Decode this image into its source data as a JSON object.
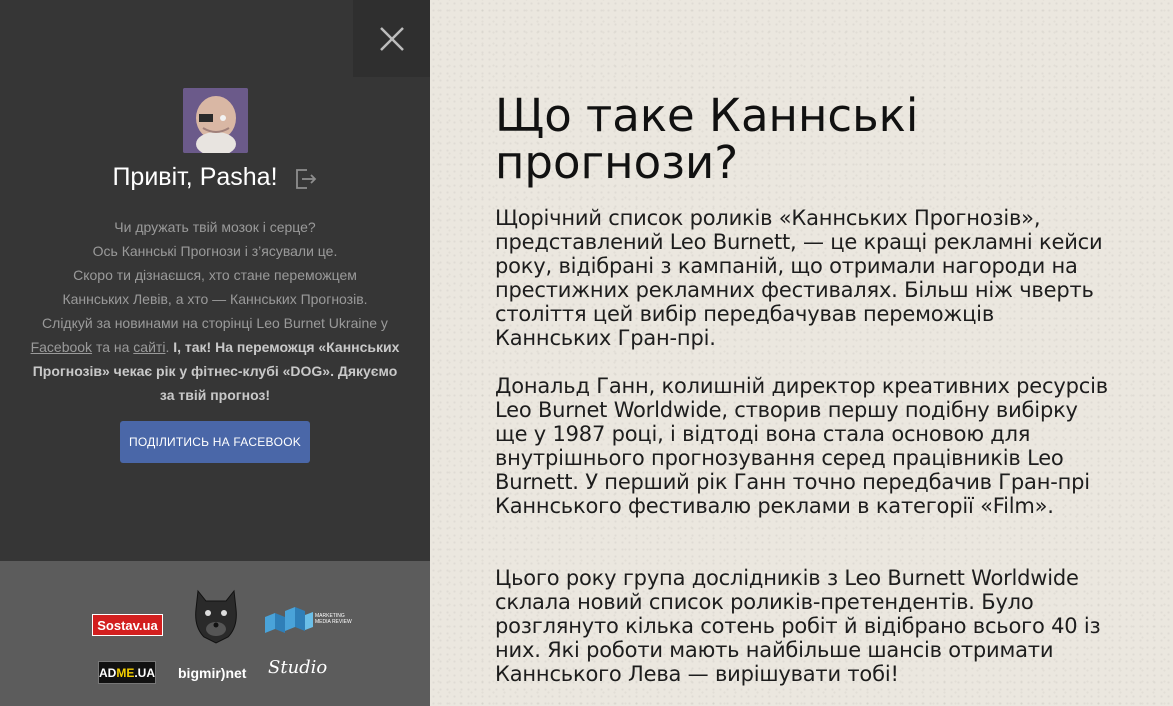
{
  "sidebar": {
    "close_icon": "close-icon",
    "avatar_icon": "avatar",
    "greeting": "Привіт, Pasha!",
    "logout_icon": "logout-icon",
    "intro": {
      "line1": "Чи дружать твій мозок і серце?",
      "line2": "Ось Каннські Прогнози і з’ясували це.",
      "line3": "Скоро ти дізнаєшся, хто стане переможцем",
      "line4": "Каннських Левів, а хто — Каннських Прогнозів.",
      "line5": "Слідкуй за новинами на сторінці Leo Burnet Ukraine у",
      "facebook_link": "Facebook",
      "and_on": " та на ",
      "site_link": "сайті",
      "dot": ". ",
      "bold_text": "І, так! На переможця «Каннських Прогнозів» чекає рік у фітнес-клубі «DOG». Дякуємо за твій прогноз!"
    },
    "share_button": "ПОДІЛИТИСЬ НА FACEBOOK",
    "partners": {
      "sostav": "Sostav.ua",
      "mmr_label": "MARKETING MEDIA REVIEW",
      "adme_ad": "AD",
      "adme_me": "ME",
      "adme_ua": ".UA",
      "bigmir": "bigmir)net",
      "studio": "Studio"
    }
  },
  "content": {
    "title": "Що таке Каннські прогнози?",
    "paragraph1": "Щорічний список роликів «Каннських Прогнозів», представлений Leo Burnett, — це кращі рекламні кейси року, відібрані з кампаній, що отримали нагороди на престижних рекламних фестивалях. Більш ніж чверть століття цей вибір передбачував переможців Каннських Гран-прі.",
    "paragraph2": "Дональд Ганн, колишній директор креативних ресурсів Leo Burnet Worldwide, створив першу подібну вибірку ще у 1987 році, і відтоді вона стала основою для внутрішнього прогнозування серед працівників Leo Burnett. У перший рік Ганн точно передбачив Гран-прі Каннського фестивалю реклами в категорії «Film».",
    "paragraph3": "Цього року група дослідників з Leo Burnett Worldwide склала новий список роликів-претендентів. Було розглянуто кілька сотень робіт й відібрано всього 40 із них. Які роботи мають найбільше шансів отримати Каннського Лева — вирішувати тобі!"
  },
  "colors": {
    "sidebar_bg": "#363636",
    "partners_bg": "#5c5c5c",
    "share_button_bg": "#4a67a8"
  }
}
